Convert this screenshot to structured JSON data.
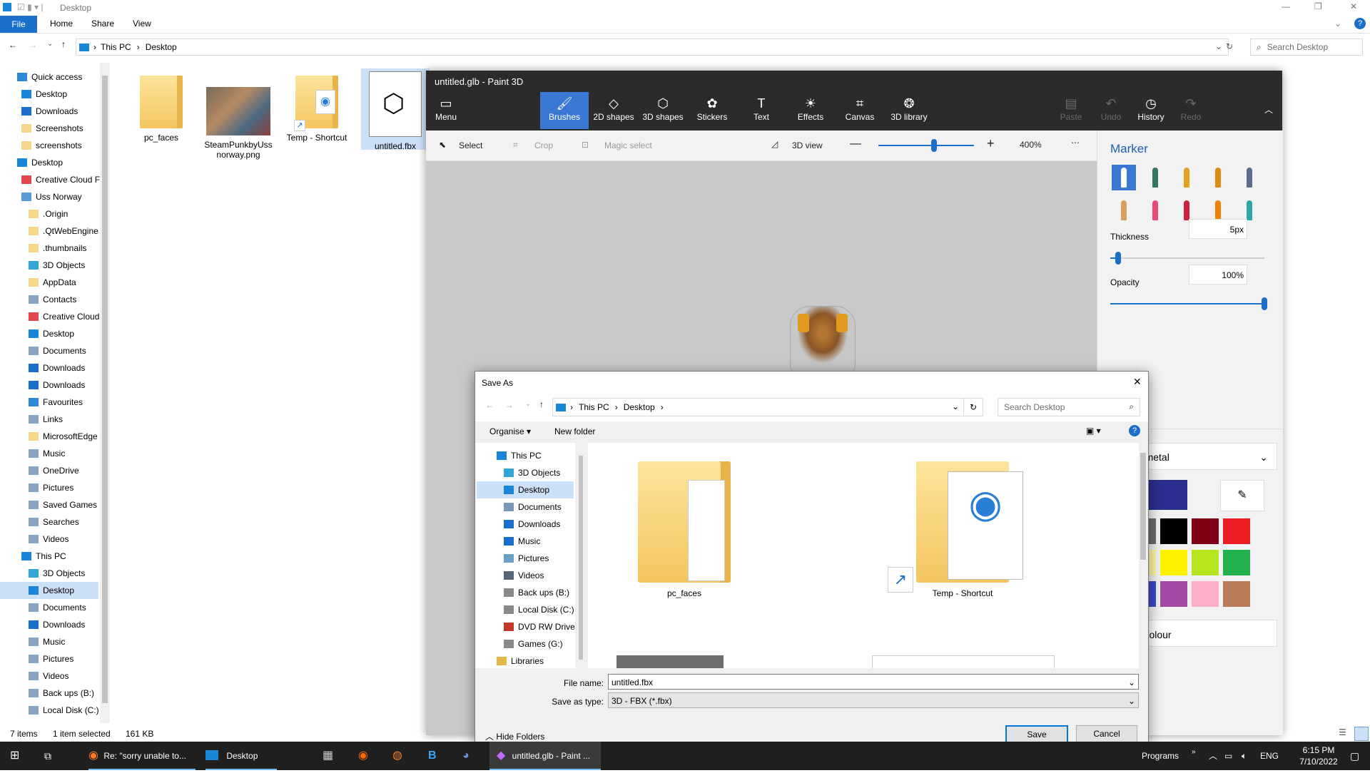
{
  "explorer": {
    "title": "Desktop",
    "menu_tabs": [
      "File",
      "Home",
      "Share",
      "View"
    ],
    "breadcrumb": [
      "This PC",
      "Desktop"
    ],
    "search_placeholder": "Search Desktop",
    "nav": [
      {
        "label": "Quick access",
        "icon": "star-icon",
        "indent": 0
      },
      {
        "label": "Desktop",
        "icon": "desktop-icon",
        "indent": 1
      },
      {
        "label": "Downloads",
        "icon": "download-icon",
        "indent": 1
      },
      {
        "label": "Screenshots",
        "icon": "folder-icon",
        "indent": 1
      },
      {
        "label": "screenshots",
        "icon": "folder-icon",
        "indent": 1
      },
      {
        "label": "Desktop",
        "icon": "desktop-icon",
        "indent": 0
      },
      {
        "label": "Creative Cloud F",
        "icon": "creative-cloud-icon",
        "indent": 1
      },
      {
        "label": "Uss Norway",
        "icon": "user-icon",
        "indent": 1
      },
      {
        "label": ".Origin",
        "icon": "folder-icon",
        "indent": 2
      },
      {
        "label": ".QtWebEngine",
        "icon": "folder-icon",
        "indent": 2
      },
      {
        "label": ".thumbnails",
        "icon": "folder-icon",
        "indent": 2
      },
      {
        "label": "3D Objects",
        "icon": "3d-objects-icon",
        "indent": 2
      },
      {
        "label": "AppData",
        "icon": "folder-icon",
        "indent": 2
      },
      {
        "label": "Contacts",
        "icon": "contacts-icon",
        "indent": 2
      },
      {
        "label": "Creative Cloud",
        "icon": "creative-cloud-icon",
        "indent": 2
      },
      {
        "label": "Desktop",
        "icon": "desktop-icon",
        "indent": 2
      },
      {
        "label": "Documents",
        "icon": "documents-icon",
        "indent": 2
      },
      {
        "label": "Downloads",
        "icon": "download-icon",
        "indent": 2
      },
      {
        "label": "Downloads",
        "icon": "download-icon",
        "indent": 2
      },
      {
        "label": "Favourites",
        "icon": "star-icon",
        "indent": 2
      },
      {
        "label": "Links",
        "icon": "links-icon",
        "indent": 2
      },
      {
        "label": "MicrosoftEdge",
        "icon": "folder-icon",
        "indent": 2
      },
      {
        "label": "Music",
        "icon": "music-icon",
        "indent": 2
      },
      {
        "label": "OneDrive",
        "icon": "onedrive-icon",
        "indent": 2
      },
      {
        "label": "Pictures",
        "icon": "pictures-icon",
        "indent": 2
      },
      {
        "label": "Saved Games",
        "icon": "saved-games-icon",
        "indent": 2
      },
      {
        "label": "Searches",
        "icon": "search-icon",
        "indent": 2
      },
      {
        "label": "Videos",
        "icon": "videos-icon",
        "indent": 2
      },
      {
        "label": "This PC",
        "icon": "pc-icon",
        "indent": 1
      },
      {
        "label": "3D Objects",
        "icon": "3d-objects-icon",
        "indent": 2
      },
      {
        "label": "Desktop",
        "icon": "desktop-icon",
        "indent": 2,
        "selected": true
      },
      {
        "label": "Documents",
        "icon": "documents-icon",
        "indent": 2
      },
      {
        "label": "Downloads",
        "icon": "download-icon",
        "indent": 2
      },
      {
        "label": "Music",
        "icon": "music-icon",
        "indent": 2
      },
      {
        "label": "Pictures",
        "icon": "pictures-icon",
        "indent": 2
      },
      {
        "label": "Videos",
        "icon": "videos-icon",
        "indent": 2
      },
      {
        "label": "Back ups (B:)",
        "icon": "drive-icon",
        "indent": 2
      },
      {
        "label": "Local Disk (C:)",
        "icon": "drive-icon",
        "indent": 2
      }
    ],
    "files": [
      "pc_faces",
      "SteamPunkbyUss norway.png",
      "Temp - Shortcut",
      "untitled.fbx"
    ],
    "status": {
      "items": "7 items",
      "selected": "1 item selected",
      "size": "161 KB"
    }
  },
  "paint": {
    "title": "untitled.glb - Paint 3D",
    "menu_label": "Menu",
    "tools": [
      {
        "label": "Brushes",
        "icon": "brush-icon",
        "active": true
      },
      {
        "label": "2D shapes",
        "icon": "2d-shapes-icon"
      },
      {
        "label": "3D shapes",
        "icon": "3d-shapes-icon"
      },
      {
        "label": "Stickers",
        "icon": "stickers-icon"
      },
      {
        "label": "Text",
        "icon": "text-icon"
      },
      {
        "label": "Effects",
        "icon": "effects-icon"
      },
      {
        "label": "Canvas",
        "icon": "canvas-icon"
      },
      {
        "label": "3D library",
        "icon": "3d-library-icon"
      }
    ],
    "right_tools": [
      {
        "label": "Paste",
        "icon": "paste-icon",
        "enabled": false
      },
      {
        "label": "Undo",
        "icon": "undo-icon",
        "enabled": false
      },
      {
        "label": "History",
        "icon": "history-icon",
        "enabled": true
      },
      {
        "label": "Redo",
        "icon": "redo-icon",
        "enabled": false
      }
    ],
    "subbar": {
      "select": "Select",
      "crop": "Crop",
      "magic_select": "Magic select",
      "view_3d": "3D view",
      "zoom": "400%",
      "zoom_level": 0.58
    },
    "side": {
      "title": "Marker",
      "thickness_label": "Thickness",
      "thickness_value": "5px",
      "thickness_level": 0.05,
      "opacity_label": "Opacity",
      "opacity_value": "100%",
      "opacity_level": 1.0,
      "material": "Polished metal",
      "add_colour": "Add colour",
      "current_colour": "#2a2f8f",
      "palette": [
        "#d3d3d3",
        "#6b6b6b",
        "#000000",
        "#7f0015",
        "#ed1c24",
        "#ffc20e",
        "#fff5a5",
        "#fff200",
        "#b5e61d",
        "#22b14c",
        "#00a2e8",
        "#3f48cc",
        "#a349a4",
        "#ffaec9",
        "#b97a57"
      ]
    }
  },
  "dialog": {
    "title": "Save As",
    "breadcrumb": [
      "This PC",
      "Desktop"
    ],
    "search_placeholder": "Search Desktop",
    "organise": "Organise",
    "new_folder": "New folder",
    "tree": [
      {
        "label": "This PC",
        "icon": "pc-icon",
        "level": 0
      },
      {
        "label": "3D Objects",
        "icon": "3d-objects-icon",
        "level": 1
      },
      {
        "label": "Desktop",
        "icon": "desktop-icon",
        "level": 1,
        "selected": true
      },
      {
        "label": "Documents",
        "icon": "documents-icon",
        "level": 1
      },
      {
        "label": "Downloads",
        "icon": "download-icon",
        "level": 1
      },
      {
        "label": "Music",
        "icon": "music-icon",
        "level": 1
      },
      {
        "label": "Pictures",
        "icon": "pictures-icon",
        "level": 1
      },
      {
        "label": "Videos",
        "icon": "videos-icon",
        "level": 1
      },
      {
        "label": "Back ups (B:)",
        "icon": "drive-icon",
        "level": 1
      },
      {
        "label": "Local Disk (C:)",
        "icon": "drive-icon",
        "level": 1
      },
      {
        "label": "DVD RW Drive",
        "icon": "dvd-icon",
        "level": 1
      },
      {
        "label": "Games (G:)",
        "icon": "drive-icon",
        "level": 1
      },
      {
        "label": "Libraries",
        "icon": "libraries-icon",
        "level": 0
      }
    ],
    "items": [
      "pc_faces",
      "Temp - Shortcut"
    ],
    "file_name_label": "File name:",
    "file_name_value": "untitled.fbx",
    "save_type_label": "Save as type:",
    "save_type_value": "3D - FBX (*.fbx)",
    "hide_folders": "Hide Folders",
    "save": "Save",
    "cancel": "Cancel"
  },
  "taskbar": {
    "apps": [
      {
        "label": "Re: \"sorry unable to...",
        "icon": "firefox-icon"
      },
      {
        "label": "Desktop",
        "icon": "explorer-icon"
      },
      {
        "label": "untitled.glb - Paint ...",
        "icon": "paint3d-icon",
        "active": true
      }
    ],
    "programs": "Programs",
    "lang": "ENG",
    "time": "6:15 PM",
    "date": "7/10/2022"
  }
}
